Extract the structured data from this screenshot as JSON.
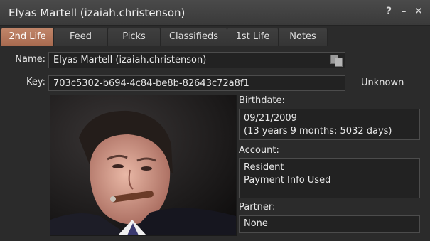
{
  "window": {
    "title": "Elyas Martell (izaiah.christenson)",
    "help_glyph": "?",
    "minimize_glyph": "–",
    "close_glyph": "✕"
  },
  "tabs": [
    {
      "label": "2nd Life",
      "active": true
    },
    {
      "label": "Feed",
      "active": false
    },
    {
      "label": "Picks",
      "active": false
    },
    {
      "label": "Classifieds",
      "active": false
    },
    {
      "label": "1st Life",
      "active": false
    },
    {
      "label": "Notes",
      "active": false
    }
  ],
  "profile": {
    "name_label": "Name:",
    "name_value": "Elyas Martell (izaiah.christenson)",
    "key_label": "Key:",
    "key_value": "703c5302-b694-4c84-be8b-82643c72a8f1",
    "online_status": "Unknown",
    "birthdate_label": "Birthdate:",
    "birthdate_line1": "09/21/2009",
    "birthdate_line2": "(13 years 9 months; 5032 days)",
    "account_label": "Account:",
    "account_line1": "Resident",
    "account_line2": "Payment Info Used",
    "partner_label": "Partner:",
    "partner_value": "None"
  },
  "icons": {
    "copy": "copy-icon"
  }
}
